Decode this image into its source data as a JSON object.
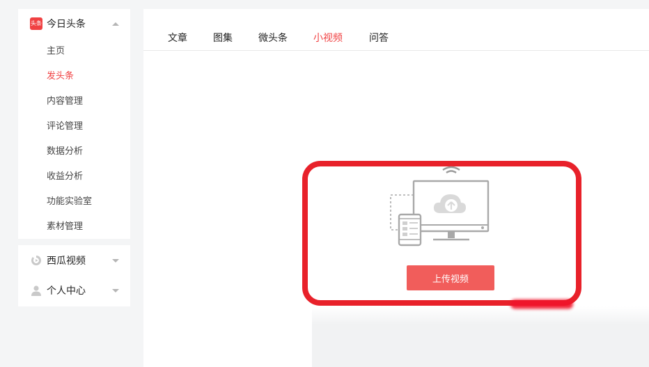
{
  "sidebar": {
    "toutiao": {
      "logo_text": "头条",
      "title": "今日头条",
      "items": [
        "主页",
        "发头条",
        "内容管理",
        "评论管理",
        "数据分析",
        "收益分析",
        "功能实验室",
        "素材管理"
      ],
      "active_item": "发头条"
    },
    "xigua": {
      "title": "西瓜视频"
    },
    "personal": {
      "title": "个人中心"
    }
  },
  "tabs": {
    "items": [
      "文章",
      "图集",
      "微头条",
      "小视频",
      "问答"
    ],
    "active": "小视频"
  },
  "upload": {
    "button_label": "上传视频"
  },
  "colors": {
    "accent": "#f04142",
    "button": "#f15d5b",
    "highlight_border": "#e8212a"
  }
}
